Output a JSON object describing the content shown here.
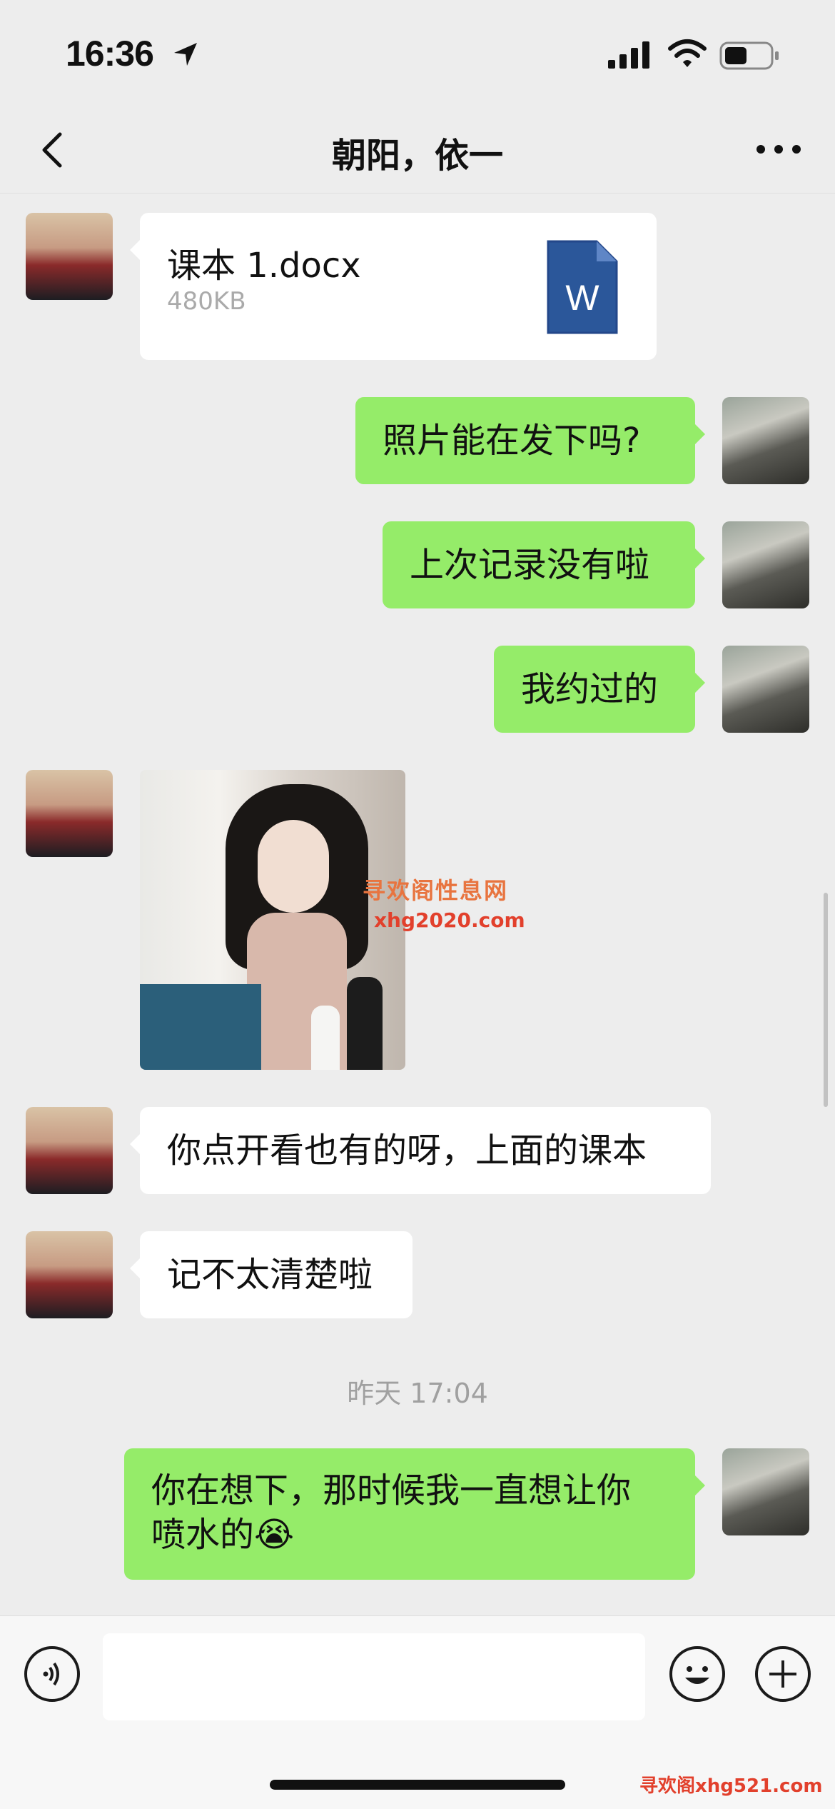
{
  "status_bar": {
    "time": "16:36"
  },
  "nav": {
    "title": "朝阳，依一"
  },
  "messages": {
    "file": {
      "name": "课本 1.docx",
      "size": "480KB",
      "icon_letter": "W"
    },
    "m1": "照片能在发下吗?",
    "m2": "上次记录没有啦",
    "m3": "我约过的",
    "photo_watermark_cn": "寻欢阁性息网",
    "photo_watermark_url": "xhg2020.com",
    "m4": "你点开看也有的呀，上面的课本",
    "m5": "记不太清楚啦",
    "timestamp": "昨天 17:04",
    "m6_line1": "你在想下，那时候我一直想让你",
    "m6_line2": "喷水的",
    "m6_emoji": "😭"
  },
  "footer_watermark": "寻欢阁xhg521.com",
  "colors": {
    "sent_bubble": "#95ec69",
    "received_bubble": "#ffffff",
    "background": "#ededed",
    "word_blue": "#2b579a"
  },
  "icons": [
    "location-arrow-icon",
    "signal-icon",
    "wifi-icon",
    "battery-icon",
    "back-chevron-icon",
    "more-dots-icon",
    "word-doc-icon",
    "voice-icon",
    "emoji-icon",
    "plus-icon"
  ]
}
